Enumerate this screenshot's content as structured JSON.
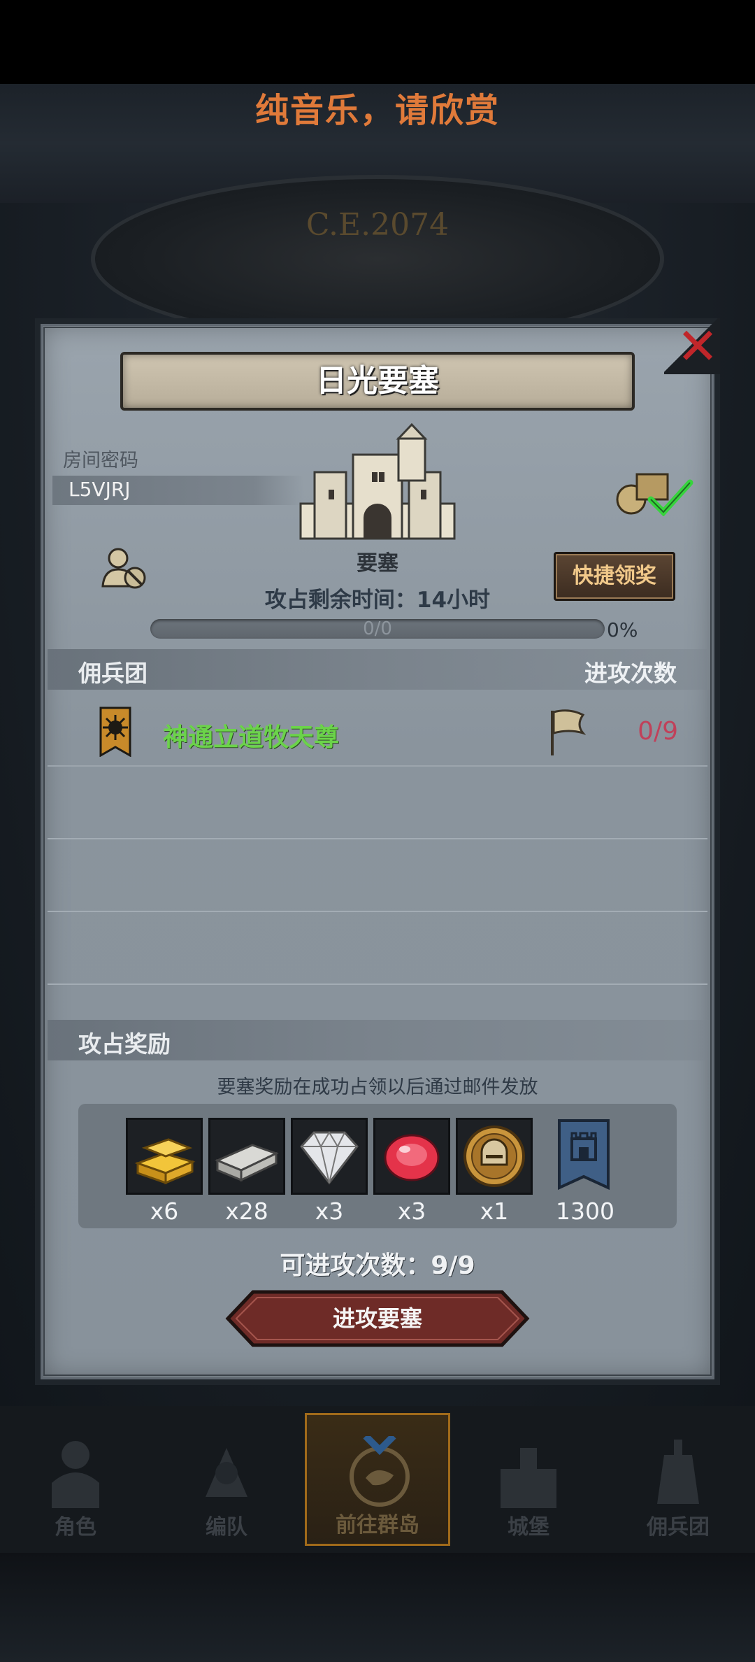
{
  "banner": {
    "text": "纯音乐，请欣赏"
  },
  "background": {
    "era_text": "C.E.2074"
  },
  "dialog": {
    "title": "日光要塞",
    "close_icon": "close-x-icon",
    "room_password_label": "房间密码",
    "room_password": "L5VJRJ",
    "fortress_label": "要塞",
    "quick_claim_label": "快捷领奖",
    "timer_text": "攻占剩余时间：14小时",
    "progress": {
      "text": "0/0",
      "percent_text": "0%",
      "fraction": 0
    },
    "mercenary_section": {
      "title": "佣兵团",
      "right_header": "进攻次数"
    },
    "mercenaries": [
      {
        "name": "神通立道牧天尊",
        "attacks": "0/9"
      }
    ],
    "reward_section": {
      "title": "攻占奖励",
      "note": "要塞奖励在成功占领以后通过邮件发放"
    },
    "rewards": [
      {
        "icon": "gold-bar-icon",
        "count": "x6"
      },
      {
        "icon": "silver-bar-icon",
        "count": "x28"
      },
      {
        "icon": "diamond-icon",
        "count": "x3"
      },
      {
        "icon": "ruby-icon",
        "count": "x3"
      },
      {
        "icon": "helmet-coin-icon",
        "count": "x1"
      },
      {
        "icon": "castle-banner-icon",
        "count": "1300"
      }
    ],
    "attacks_left": "可进攻次数：9/9",
    "attack_button": "进攻要塞"
  },
  "bottom_nav": [
    {
      "label": "角色",
      "icon": "character-icon",
      "active": false
    },
    {
      "label": "编队",
      "icon": "formation-icon",
      "active": false
    },
    {
      "label": "前往群岛",
      "icon": "islands-icon",
      "active": true
    },
    {
      "label": "城堡",
      "icon": "castle-icon",
      "active": false
    },
    {
      "label": "佣兵团",
      "icon": "mercenary-icon",
      "active": false
    }
  ],
  "colors": {
    "banner_text": "#e07a3a",
    "merc_name": "#6bd34a",
    "attack_count": "#c0415a",
    "close": "#c0262a",
    "quick_btn_text": "#f1c98a"
  }
}
